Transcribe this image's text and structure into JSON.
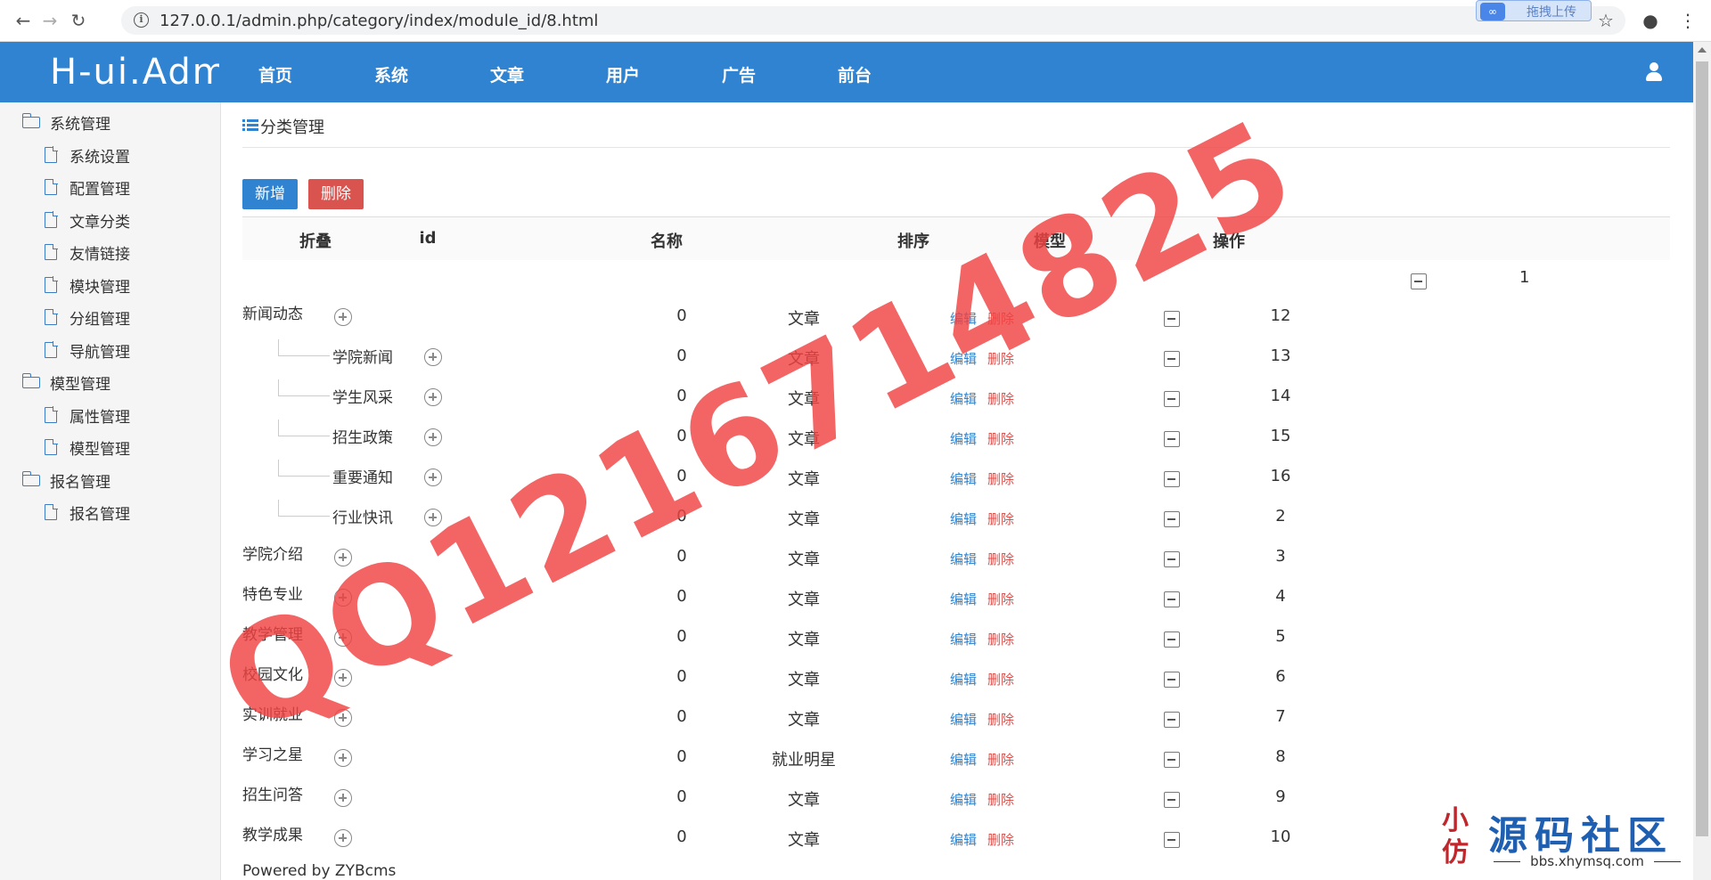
{
  "browser": {
    "url": "127.0.0.1/admin.php/category/index/module_id/8.html",
    "upload_label": "拖拽上传"
  },
  "header": {
    "logo": "H-ui.Admin",
    "menu": [
      "首页",
      "系统",
      "文章",
      "用户",
      "广告",
      "前台"
    ]
  },
  "sidebar": [
    {
      "type": "group",
      "label": "系统管理"
    },
    {
      "type": "item",
      "label": "系统设置"
    },
    {
      "type": "item",
      "label": "配置管理"
    },
    {
      "type": "item",
      "label": "文章分类"
    },
    {
      "type": "item",
      "label": "友情链接"
    },
    {
      "type": "item",
      "label": "模块管理"
    },
    {
      "type": "item",
      "label": "分组管理"
    },
    {
      "type": "item",
      "label": "导航管理"
    },
    {
      "type": "group",
      "label": "模型管理"
    },
    {
      "type": "item",
      "label": "属性管理"
    },
    {
      "type": "item",
      "label": "模型管理"
    },
    {
      "type": "group",
      "label": "报名管理"
    },
    {
      "type": "item",
      "label": "报名管理"
    }
  ],
  "main": {
    "title": "分类管理",
    "add_label": "新增",
    "delete_label": "删除",
    "columns": [
      "折叠",
      "id",
      "名称",
      "排序",
      "模型",
      "操作"
    ],
    "extra_value": "1",
    "edit_label": "编辑",
    "row_delete_label": "删除",
    "rows": [
      {
        "name": "新闻动态",
        "level": 0,
        "sort": "0",
        "model": "文章",
        "id": "12"
      },
      {
        "name": "学院新闻",
        "level": 1,
        "sort": "0",
        "model": "文章",
        "id": "13"
      },
      {
        "name": "学生风采",
        "level": 1,
        "sort": "0",
        "model": "文章",
        "id": "14"
      },
      {
        "name": "招生政策",
        "level": 1,
        "sort": "0",
        "model": "文章",
        "id": "15"
      },
      {
        "name": "重要通知",
        "level": 1,
        "sort": "0",
        "model": "文章",
        "id": "16"
      },
      {
        "name": "行业快讯",
        "level": 1,
        "last": true,
        "sort": "0",
        "model": "文章",
        "id": "2"
      },
      {
        "name": "学院介绍",
        "level": 0,
        "sort": "0",
        "model": "文章",
        "id": "3"
      },
      {
        "name": "特色专业",
        "level": 0,
        "sort": "0",
        "model": "文章",
        "id": "4"
      },
      {
        "name": "教学管理",
        "level": 0,
        "sort": "0",
        "model": "文章",
        "id": "5"
      },
      {
        "name": "校园文化",
        "level": 0,
        "sort": "0",
        "model": "文章",
        "id": "6"
      },
      {
        "name": "实训就业",
        "level": 0,
        "sort": "0",
        "model": "文章",
        "id": "7"
      },
      {
        "name": "学习之星",
        "level": 0,
        "sort": "0",
        "model": "就业明星",
        "id": "8"
      },
      {
        "name": "招生问答",
        "level": 0,
        "sort": "0",
        "model": "文章",
        "id": "9"
      },
      {
        "name": "教学成果",
        "level": 0,
        "sort": "0",
        "model": "文章",
        "id": "10"
      }
    ],
    "footer": "Powered by ZYBcms"
  },
  "watermark": "QQ1216714825",
  "corner_logo": {
    "seal": "小 仿",
    "title": "源码社区",
    "url": "bbs.xhymsq.com"
  }
}
